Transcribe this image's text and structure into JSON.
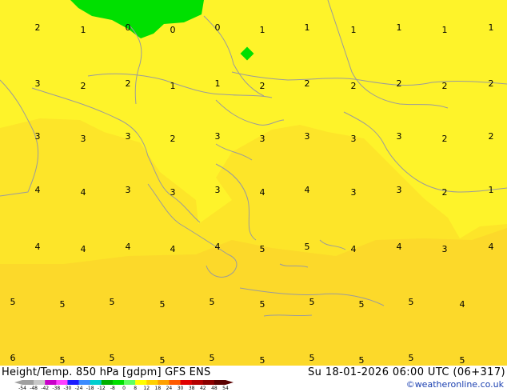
{
  "title_left": "Height/Temp. 850 hPa [gdpm] GFS ENS",
  "title_right": "Su 18-01-2026 06:00 UTC (06+317)",
  "credit": "©weatheronline.co.uk",
  "colors": {
    "zone_yellow": "#fef32a",
    "zone_light_orange": "#fde529",
    "zone_orange": "#fcd92a",
    "green_blob": "#00e000",
    "coast_line": "#9b9b9b"
  },
  "colorbar": {
    "ticks": [
      "-54",
      "-48",
      "-42",
      "-38",
      "-30",
      "-24",
      "-18",
      "-12",
      "-8",
      "0",
      "8",
      "12",
      "18",
      "24",
      "30",
      "38",
      "42",
      "48",
      "54"
    ],
    "colors": [
      "#a0a0a0",
      "#c8c8c8",
      "#c800c8",
      "#ff40ff",
      "#1c1cff",
      "#3b8bff",
      "#00cfcf",
      "#00b000",
      "#00e000",
      "#60ff60",
      "#ffff00",
      "#ffd000",
      "#ffa000",
      "#ff5a00",
      "#e00000",
      "#b40000",
      "#8a0000",
      "#5a0000"
    ]
  },
  "grid_values": [
    [
      "2",
      "1",
      "0",
      "0",
      "0",
      "1",
      "1",
      "1",
      "1",
      "1",
      "1"
    ],
    [
      "3",
      "2",
      "2",
      "1",
      "1",
      "2",
      "2",
      "2",
      "2",
      "2",
      "2"
    ],
    [
      "3",
      "3",
      "3",
      "2",
      "3",
      "3",
      "3",
      "3",
      "3",
      "2",
      "2"
    ],
    [
      "4",
      "4",
      "3",
      "3",
      "3",
      "4",
      "4",
      "3",
      "3",
      "2",
      "1"
    ],
    [
      "4",
      "4",
      "4",
      "4",
      "4",
      "5",
      "5",
      "4",
      "4",
      "3",
      "4"
    ],
    [
      "5",
      "5",
      "5",
      "5",
      "5",
      "5",
      "5",
      "5",
      "5",
      "4"
    ],
    [
      "6",
      "5",
      "5",
      "5",
      "5",
      "5",
      "5",
      "5",
      "5",
      "5"
    ]
  ]
}
